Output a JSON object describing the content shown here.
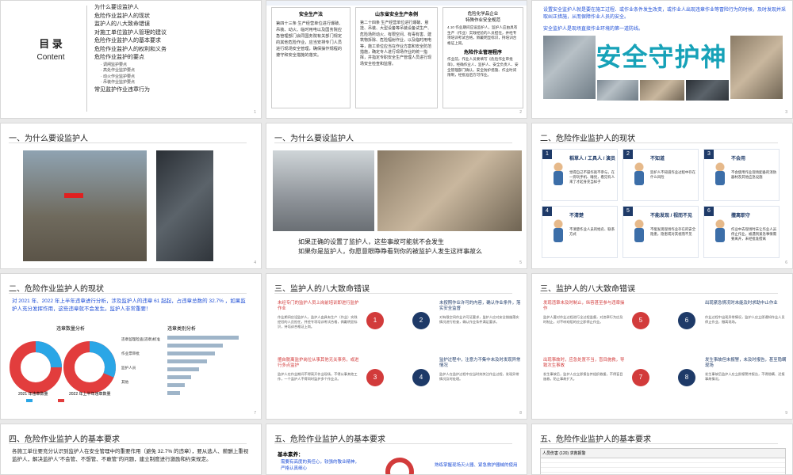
{
  "toc": {
    "title": "目 录",
    "subtitle": "Content",
    "items": [
      "为什么要设监护人",
      "危险作业监护人的现状",
      "监护人的八大致命错误",
      "对施工单位监护人管理的建议",
      "危险作业监护人的基本要求",
      "危险作业监护人的权利和义务",
      "危险作业监护的要点"
    ],
    "subitems": [
      "调闸监护要点",
      "高处作业监护要点",
      "动火作业监护要点",
      "吊装作业监护要点"
    ],
    "last_item": "常见监护作业违章行为"
  },
  "law": {
    "left_title": "安全生产法",
    "left_text": "第四十三条 生产经营单位进行爆破、吊装、动火、临时用电以及国务院应急管理部门会同国务院有关部门规定的其他危险作业，应当安排专门人员进行现场安全管理，确保操作规程的遵守和安全措施的落实。",
    "mid_title": "山东省安全生产条例",
    "mid_text": "第二十四条 生产经营单位进行爆破、悬挂、吊装、大型设备等吊装设备试生产、危险场所动火、有限空间、有毒有害、建筑物拆除、危险辐射作业，以及临时用电等，施工单位应当在作业方案和安全防范措施，确定专人进行现场作业的统一指挥，并指定专职安全生产管理人员进行现场安全检查和监督。",
    "right_title1": "危险化学品企业",
    "right_title2": "特殊作业安全规范",
    "right_text": "4.10 作业期间应设监护人，监护人应由具有生产（作业）实践经验的人员担任，并经专项培训考试合格，佩戴明显标识，持培训合格证上岗。",
    "right_title3": "危险作业管理程序",
    "right_text2": "作业前，作业人员要填写《危险作业审批单》，经确作业人、监护人、安全负责人、安全管理部门确认，安全防护措施、作业时间限制，经批准后方可作业。"
  },
  "guard": {
    "text1": "设置安全监护人就是要在施工过程、或作业条件发生改变，或作业人出现违章作业等冒险行为的时候，及时发现并采取纠正措施，从而保障作业人员的安全。",
    "text2": "安全监护人是现场直接作业环境的第一道防线。",
    "banner": "安全守护神"
  },
  "s4": {
    "header": "一、为什么要设监护人"
  },
  "s5": {
    "header": "一、为什么要设监护人",
    "line1": "如果正确的设置了监护人，这些事故可能就不会发生",
    "line2": "如果你是监护人，你愿意眼睁睁看到你的被监护人发生这样事故么"
  },
  "s6": {
    "header": "二、危险作业监护人的现状",
    "cards": [
      {
        "num": "1",
        "title": "稻草人 / 工具人 / 演员",
        "text": "觉得自己不操作就不参与，在一旁玩手机、睡觉，看见有人来了才起身充当样子"
      },
      {
        "num": "2",
        "title": "不知道",
        "text": "监护人不知道作业过程中存在什么风险"
      },
      {
        "num": "3",
        "title": "不会用",
        "text": "不会使用作业现场配备的消防器材及其他应急设施"
      },
      {
        "num": "4",
        "title": "不清楚",
        "text": "不清楚作业人员的姓名、联系方式"
      },
      {
        "num": "5",
        "title": "不能发现 / 视而不见",
        "text": "不能发现现场作业存在的安全隐患，隐患或对其视而不见"
      },
      {
        "num": "6",
        "title": "擅离职守",
        "text": "作业中去现场时未让作业人员停止作业，被遇到紧急事情需要离开，未经批准擅离"
      }
    ]
  },
  "s7": {
    "header": "二、危险作业监护人的现状",
    "intro": "对 2021 年、2022 年上半年违章进行分析，涉及监护人的违章 61 起起，占违章总数的 32.7% ，如果监护人充分发挥作用，这些违章就不会发生。监护人非常重要！",
    "chart_title1": "违章数量分析",
    "chart_title2": "违章类别分析",
    "label1": "2021 年违章数量",
    "label2": "2022 年上半年违章数量",
    "side_labels": [
      "违章监理检查(违章)标准",
      "作业票审批",
      "监护人员",
      "其他"
    ]
  },
  "s8": {
    "header": "三、监护人的八大致命错误",
    "items": [
      {
        "num": "1",
        "title": "未经专门的监护人员上岗前培训即进行监护作业",
        "text": "作业期间应设监护人，监护人由具有生产（作业）实践经验的人员担任，并经专项培训考试合格，佩戴明显标识，持培训合格证上岗。"
      },
      {
        "num": "2",
        "title": "未按照作业许可的内容，确认作业条件，落实安全监督",
        "text": "对有限空间作业许可证要求，监护人应对安全措施落实情况进行检查，确认作业条件满足要求。"
      },
      {
        "num": "3",
        "title": "擅自脱离监护岗位从事其他无关事务，或进行多点监护",
        "text": "监护人在作业期间不得离开作业现场，不得从事其他工作，一个监护人不得同时监护多个作业点。"
      },
      {
        "num": "4",
        "title": "监护过程中，注意力不集中未及时发现异常情况",
        "text": "监护人在监护过程中应当时刻关注作业过程，发现异常情况及时处理。"
      }
    ]
  },
  "s9": {
    "header": "三、监护人的八大致命错误",
    "items": [
      {
        "num": "5",
        "title": "发现违章未及时制止，纵容甚至参与违章操作",
        "text": "监护人要对作业过程进行全过程监督，对违章行为应及时制止，对不听劝阻的应立即停止作业。"
      },
      {
        "num": "6",
        "title": "出现紧急情况时未能及时求助中止作业",
        "text": "作业过程中出现异常情况，监护人应立即通知作业人员停止作业，撤离现场。"
      },
      {
        "num": "7",
        "title": "出现事故时，应急处置不当，盲目施救，导致次生事故",
        "text": "发生事故后，监护人应立即报告并组织救援，不得盲目施救，防止事故扩大。"
      },
      {
        "num": "8",
        "title": "发生事故但未报警，未及时报告，甚至隐瞒现场",
        "text": "发生事故后监护人应立即报警并报告，不得隐瞒、迟报事故情况。"
      }
    ]
  },
  "s10": {
    "header": "四、危险作业监护人的基本要求",
    "text": "各施工单位要充分认识到监护人在安全管理中的重要作用（避免 32.7% 的违章），要从选人、薪酬上重视监护人，解决监护人\"不会管、不想管、不敢管\"的问题，建立制度进行激励和约束规定。"
  },
  "s11": {
    "header": "五、危险作业监护人的基本要求",
    "sub": "基本素养：",
    "item1": "需要有高度的责任心，较强的敬业精神，严格认真细心",
    "item2": "熟练掌握现场灭火器、紧急救护器械的使用"
  },
  "s12": {
    "header": "五、危险作业监护人的基本要求",
    "table_title": "人员伤害 (120) 求救报警"
  },
  "colors": {
    "navy": "#1e3a68",
    "red": "#d23b3b",
    "blue": "#1f4fd6",
    "teal": "#2a8fb4"
  }
}
